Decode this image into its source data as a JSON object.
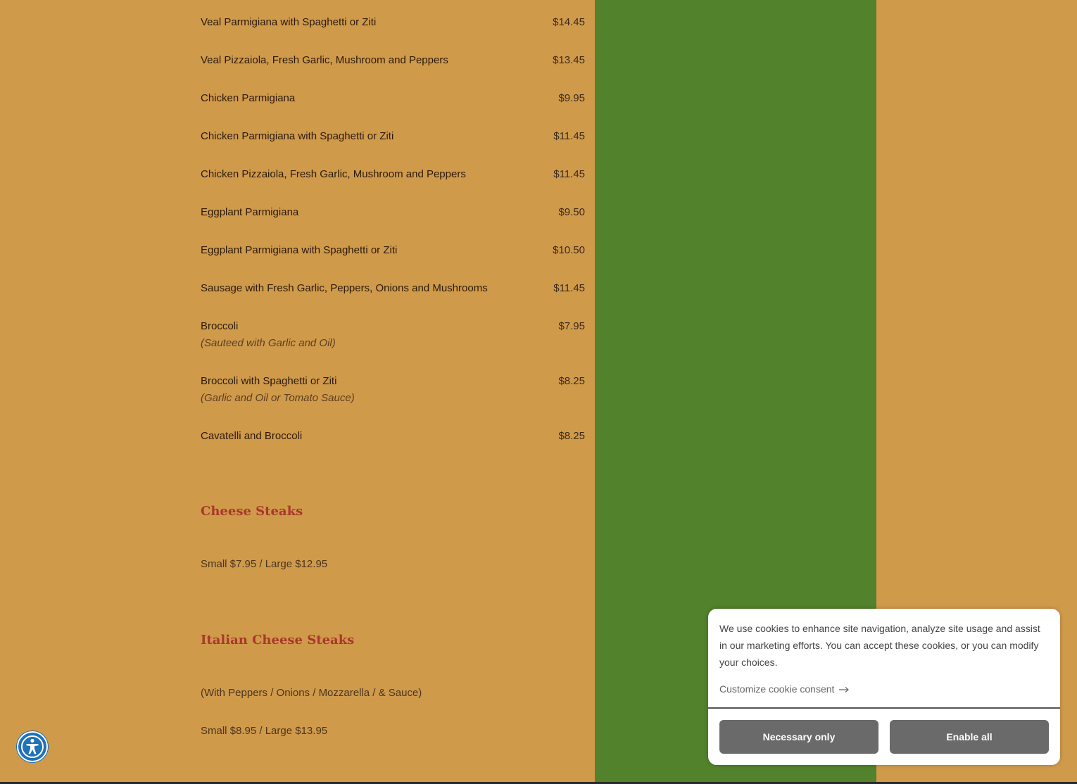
{
  "menu_items": [
    {
      "name": "Veal Parmigiana with Spaghetti or Ziti",
      "price": "$14.45",
      "desc": ""
    },
    {
      "name": "Veal Pizzaiola, Fresh Garlic, Mushroom and Peppers",
      "price": "$13.45",
      "desc": ""
    },
    {
      "name": "Chicken Parmigiana",
      "price": "$9.95",
      "desc": ""
    },
    {
      "name": "Chicken Parmigiana with Spaghetti or Ziti",
      "price": "$11.45",
      "desc": ""
    },
    {
      "name": "Chicken Pizzaiola, Fresh Garlic, Mushroom and Peppers",
      "price": "$11.45",
      "desc": ""
    },
    {
      "name": "Eggplant Parmigiana",
      "price": "$9.50",
      "desc": ""
    },
    {
      "name": "Eggplant Parmigiana with Spaghetti or Ziti",
      "price": "$10.50",
      "desc": ""
    },
    {
      "name": "Sausage with Fresh Garlic, Peppers, Onions and Mushrooms",
      "price": "$11.45",
      "desc": ""
    },
    {
      "name": "Broccoli",
      "price": "$7.95",
      "desc": "(Sauteed with Garlic and Oil)"
    },
    {
      "name": "Broccoli with Spaghetti or Ziti",
      "price": "$8.25",
      "desc": "(Garlic and Oil or Tomato Sauce)"
    },
    {
      "name": "Cavatelli and Broccoli",
      "price": "$8.25",
      "desc": ""
    }
  ],
  "cheese_steaks": {
    "title": "Cheese Steaks",
    "prices": "Small $7.95 / Large $12.95"
  },
  "italian_cheese_steaks": {
    "title": "Italian Cheese Steaks",
    "description": "(With Peppers / Onions / Mozzarella / & Sauce)",
    "prices": "Small $8.95 / Large $13.95"
  },
  "cookie_banner": {
    "message": "We use cookies to enhance site navigation, analyze site usage and assist in our marketing efforts. You can accept these cookies, or you can modify your choices.",
    "customize_label": "Customize cookie consent",
    "necessary_label": "Necessary only",
    "enable_label": "Enable all"
  },
  "accessibility_icon": "accessibility-icon",
  "colors": {
    "background": "#D09A4B",
    "sidebar_green": "#52822C",
    "heading_red": "#A8382A",
    "button_gray": "#6A6A6A",
    "a11y_blue": "#1E72B8"
  }
}
